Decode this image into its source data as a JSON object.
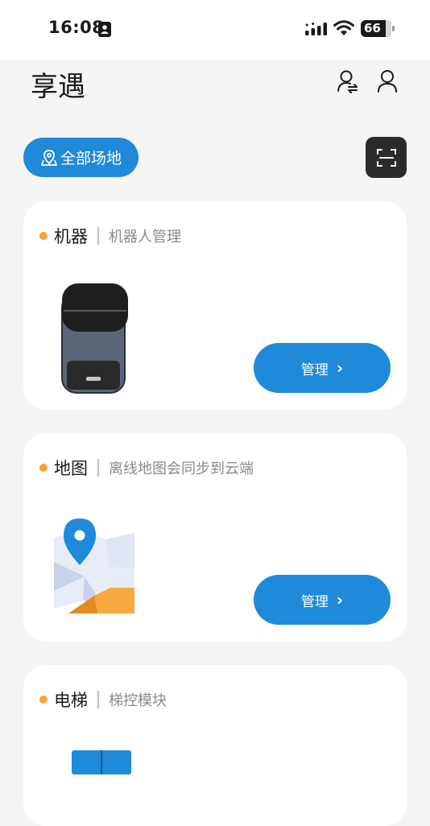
{
  "status_bar": {
    "time": "16:08",
    "battery": "66"
  },
  "header": {
    "title": "享遇"
  },
  "toolbar": {
    "site_button_label": "全部场地"
  },
  "cards": [
    {
      "title": "机器",
      "subtitle": "机器人管理",
      "button_label": "管理"
    },
    {
      "title": "地图",
      "subtitle": "离线地图会同步到云端",
      "button_label": "管理"
    },
    {
      "title": "电梯",
      "subtitle": "梯控模块"
    }
  ],
  "colors": {
    "accent": "#1e8ad9",
    "dot": "#f2a240",
    "card_bg": "#ffffff",
    "page_bg": "#f5f5f5"
  }
}
